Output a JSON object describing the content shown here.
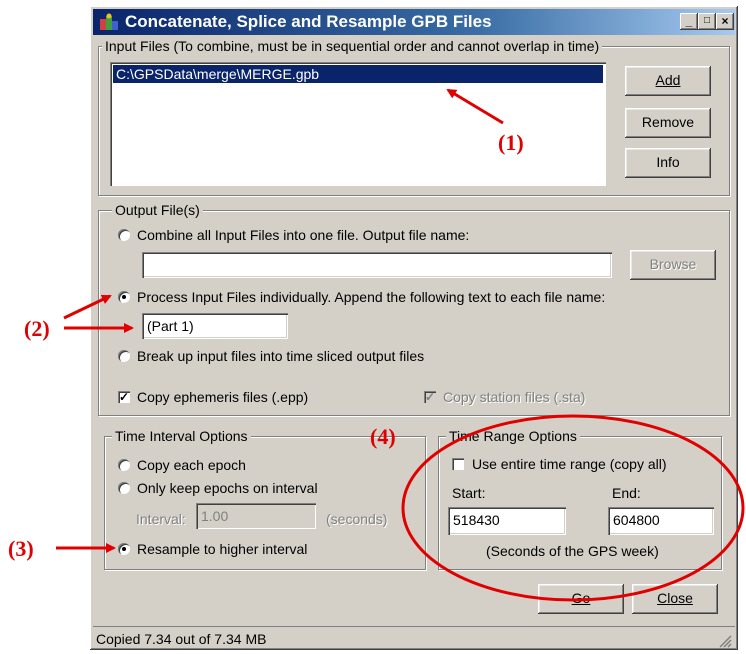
{
  "window": {
    "title": "Concatenate, Splice and Resample GPB Files",
    "controls": [
      "_",
      "□",
      "×"
    ]
  },
  "input_files": {
    "legend": "Input Files (To combine, must be in sequential order and cannot overlap in time)",
    "items": [
      "C:\\GPSData\\merge\\MERGE.gpb"
    ],
    "add_label": "Add",
    "remove_label": "Remove",
    "info_label": "Info"
  },
  "output_files": {
    "legend": "Output File(s)",
    "combine_label": "Combine all Input Files into one file. Output file name:",
    "combine_value": "",
    "browse_label": "Browse",
    "individual_label": "Process Input Files individually. Append the following text to each file name:",
    "append_value": "(Part 1)",
    "break_label": "Break up input files into time sliced output files",
    "copy_ephemeris_label": "Copy ephemeris files (.epp)",
    "copy_station_label": "Copy station files (.sta)"
  },
  "time_interval": {
    "legend": "Time Interval Options",
    "copy_each_label": "Copy each epoch",
    "only_keep_label": "Only keep epochs on interval",
    "interval_label": "Interval:",
    "interval_value": "1.00",
    "seconds_label": "(seconds)",
    "resample_label": "Resample to higher interval"
  },
  "time_range": {
    "legend": "Time Range Options",
    "use_entire_label": "Use entire time range (copy all)",
    "start_label": "Start:",
    "end_label": "End:",
    "start_value": "518430",
    "end_value": "604800",
    "note": "(Seconds of the GPS week)"
  },
  "footer": {
    "go_label": "Go",
    "close_label": "Close",
    "status": "Copied 7.34 out of 7.34 MB"
  },
  "annotations": {
    "a1": "(1)",
    "a2": "(2)",
    "a3": "(3)",
    "a4": "(4)",
    "color": "#e00000"
  }
}
